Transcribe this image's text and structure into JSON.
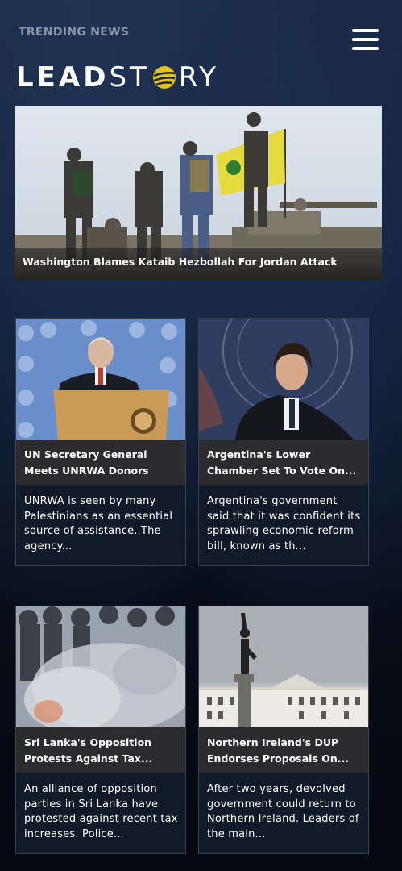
{
  "header": {
    "trending_label": "TRENDING NEWS",
    "logo_text_left": "LEAD",
    "logo_text_right": "RY",
    "logo_text_st": "ST",
    "logo_alt": "LEADSTORY",
    "menu_icon": "hamburger-menu-icon",
    "accent_color": "#e8c21c"
  },
  "hero": {
    "headline": "Washington Blames Kataib Hezbollah For Jordan Attack",
    "image": "soldiers-on-tank-with-yellow-flag"
  },
  "articles": [
    {
      "title": "UN Secretary General Meets UNRWA Donors",
      "summary": "UNRWA is seen by many Palestinians as an essential source of assistance. The agency...",
      "image": "un-secretary-general-at-podium"
    },
    {
      "title": "Argentina's Lower Chamber Set To Vote On...",
      "summary": "Argentina's government said that it was confident its sprawling economic reform bill, known as th...",
      "image": "argentina-president-portrait"
    },
    {
      "title": "Sri Lanka's Opposition Protests Against Tax...",
      "summary": "An alliance of opposition parties in Sri Lanka have protested against recent tax increases. Police...",
      "image": "riot-police-tear-gas"
    },
    {
      "title": "Northern Ireland's DUP Endorses Proposals On...",
      "summary": "After two years, devolved government could return to Northern Ireland. Leaders of the main...",
      "image": "stormont-statue"
    }
  ]
}
